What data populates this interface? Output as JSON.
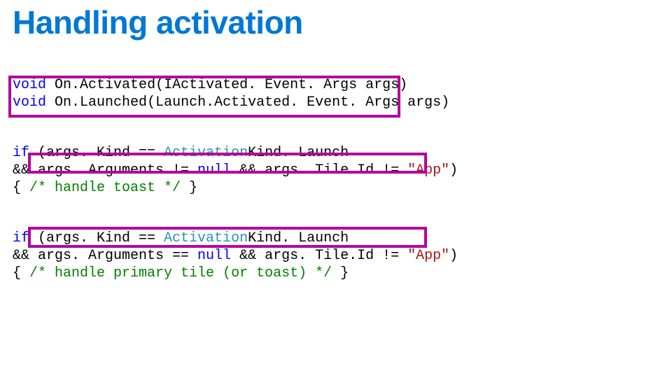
{
  "title": "Handling activation",
  "sig": {
    "kw_void1": "void",
    "name1_a": "On.",
    "name1_b": "Activated(IActivated",
    "name1_c": ". Event. Args ",
    "name1_d": "args",
    "name1_e": ")",
    "kw_void2": "void",
    "name2_a": "On.",
    "name2_b": "Launched(Launch.Activated",
    "name2_c": ". Event. Args ",
    "name2_d": "args",
    "name2_e": ")"
  },
  "b1": {
    "l1_if": "if",
    "l1_a": " (args. Kind == ",
    "l1_b": "Activation",
    "l1_c": "Kind. Launch",
    "l2_a": "&& args. Arguments != ",
    "l2_null": "null",
    "l2_b": " && args. Tile.Id != ",
    "l2_str": "\"App\"",
    "l2_c": ")",
    "l3_a": "{ ",
    "l3_cmt": "/* handle toast */",
    "l3_b": " }"
  },
  "b2": {
    "l1_if": "if",
    "l1_a": " (args. Kind == ",
    "l1_b": "Activation",
    "l1_c": "Kind. Launch",
    "l2_a": "&& args. Arguments == ",
    "l2_null": "null",
    "l2_b": " && args. Tile.Id != ",
    "l2_str": "\"App\"",
    "l2_c": ")",
    "l3_a": "{ ",
    "l3_cmt": "/* handle primary tile (or toast) */",
    "l3_b": " }"
  }
}
